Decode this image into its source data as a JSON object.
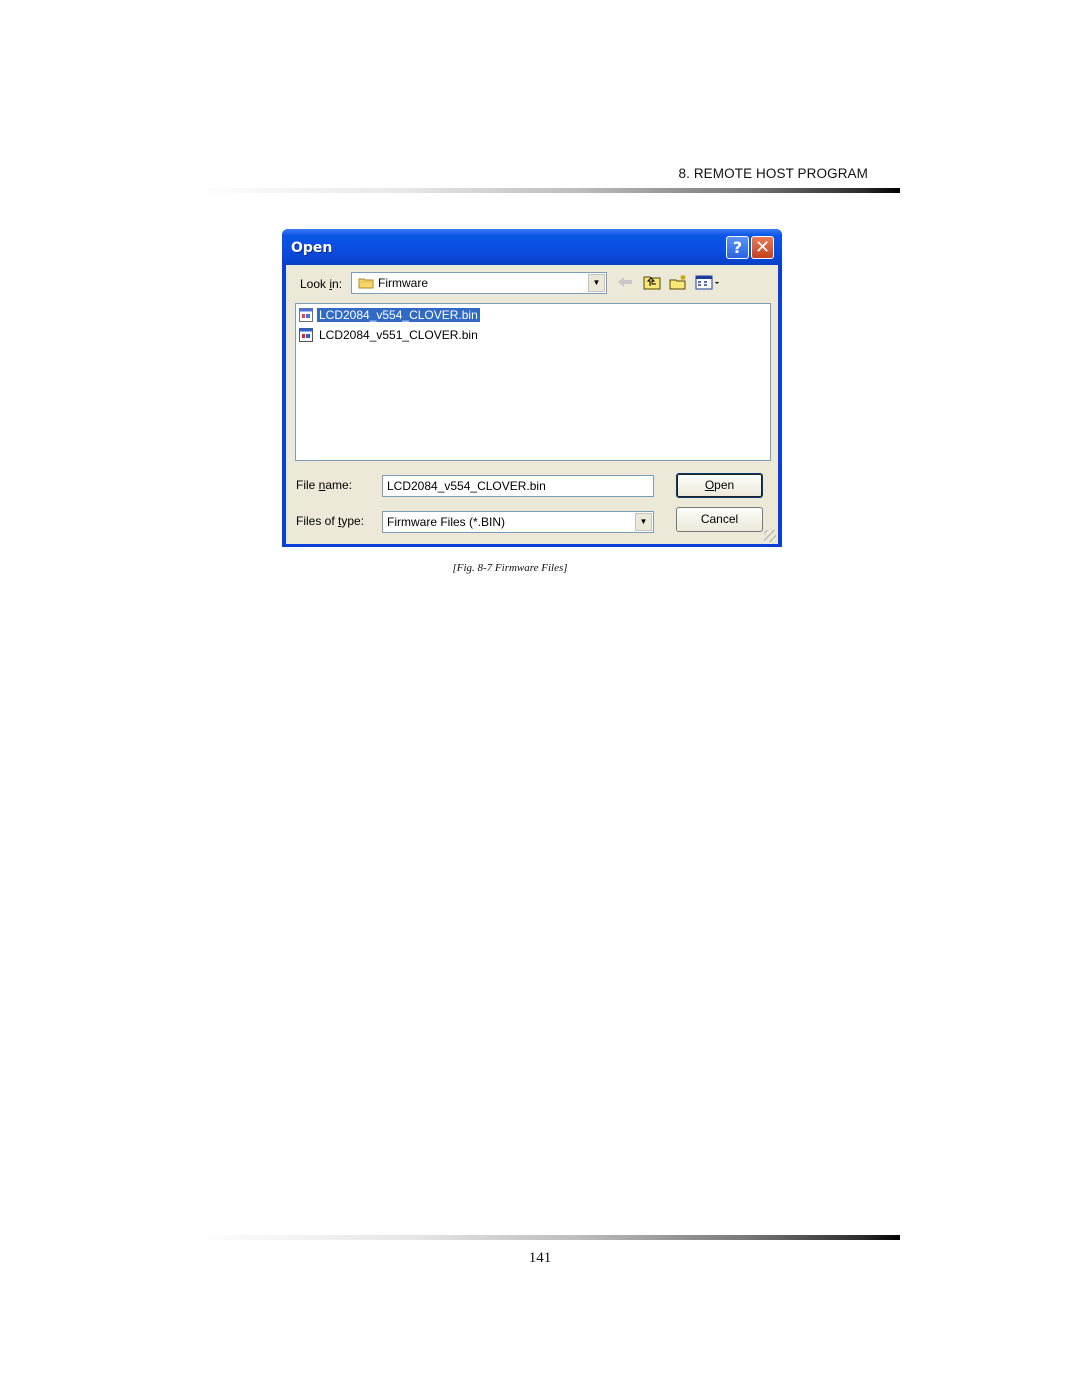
{
  "header": {
    "section_title": "8. REMOTE HOST PROGRAM"
  },
  "dialog": {
    "title": "Open",
    "help_button": "?",
    "close_button": "✕",
    "look_in": {
      "label_prefix": "Look ",
      "label_accel": "i",
      "label_suffix": "n:",
      "value": "Firmware"
    },
    "toolbar": [
      "back-icon",
      "up-folder-icon",
      "new-folder-icon",
      "view-menu-icon"
    ],
    "files": [
      {
        "name": "LCD2084_v554_CLOVER.bin",
        "selected": true
      },
      {
        "name": "LCD2084_v551_CLOVER.bin",
        "selected": false
      }
    ],
    "file_name": {
      "label_prefix": "File ",
      "label_accel": "n",
      "label_suffix": "ame:",
      "value": "LCD2084_v554_CLOVER.bin"
    },
    "file_type": {
      "label_prefix": "Files of ",
      "label_accel": "t",
      "label_suffix": "ype:",
      "value": "Firmware Files (*.BIN)"
    },
    "open_button": {
      "accel": "O",
      "rest": "pen"
    },
    "cancel_button": "Cancel"
  },
  "caption": "[Fig. 8-7 Firmware Files]",
  "footer": {
    "page_number": "141"
  }
}
